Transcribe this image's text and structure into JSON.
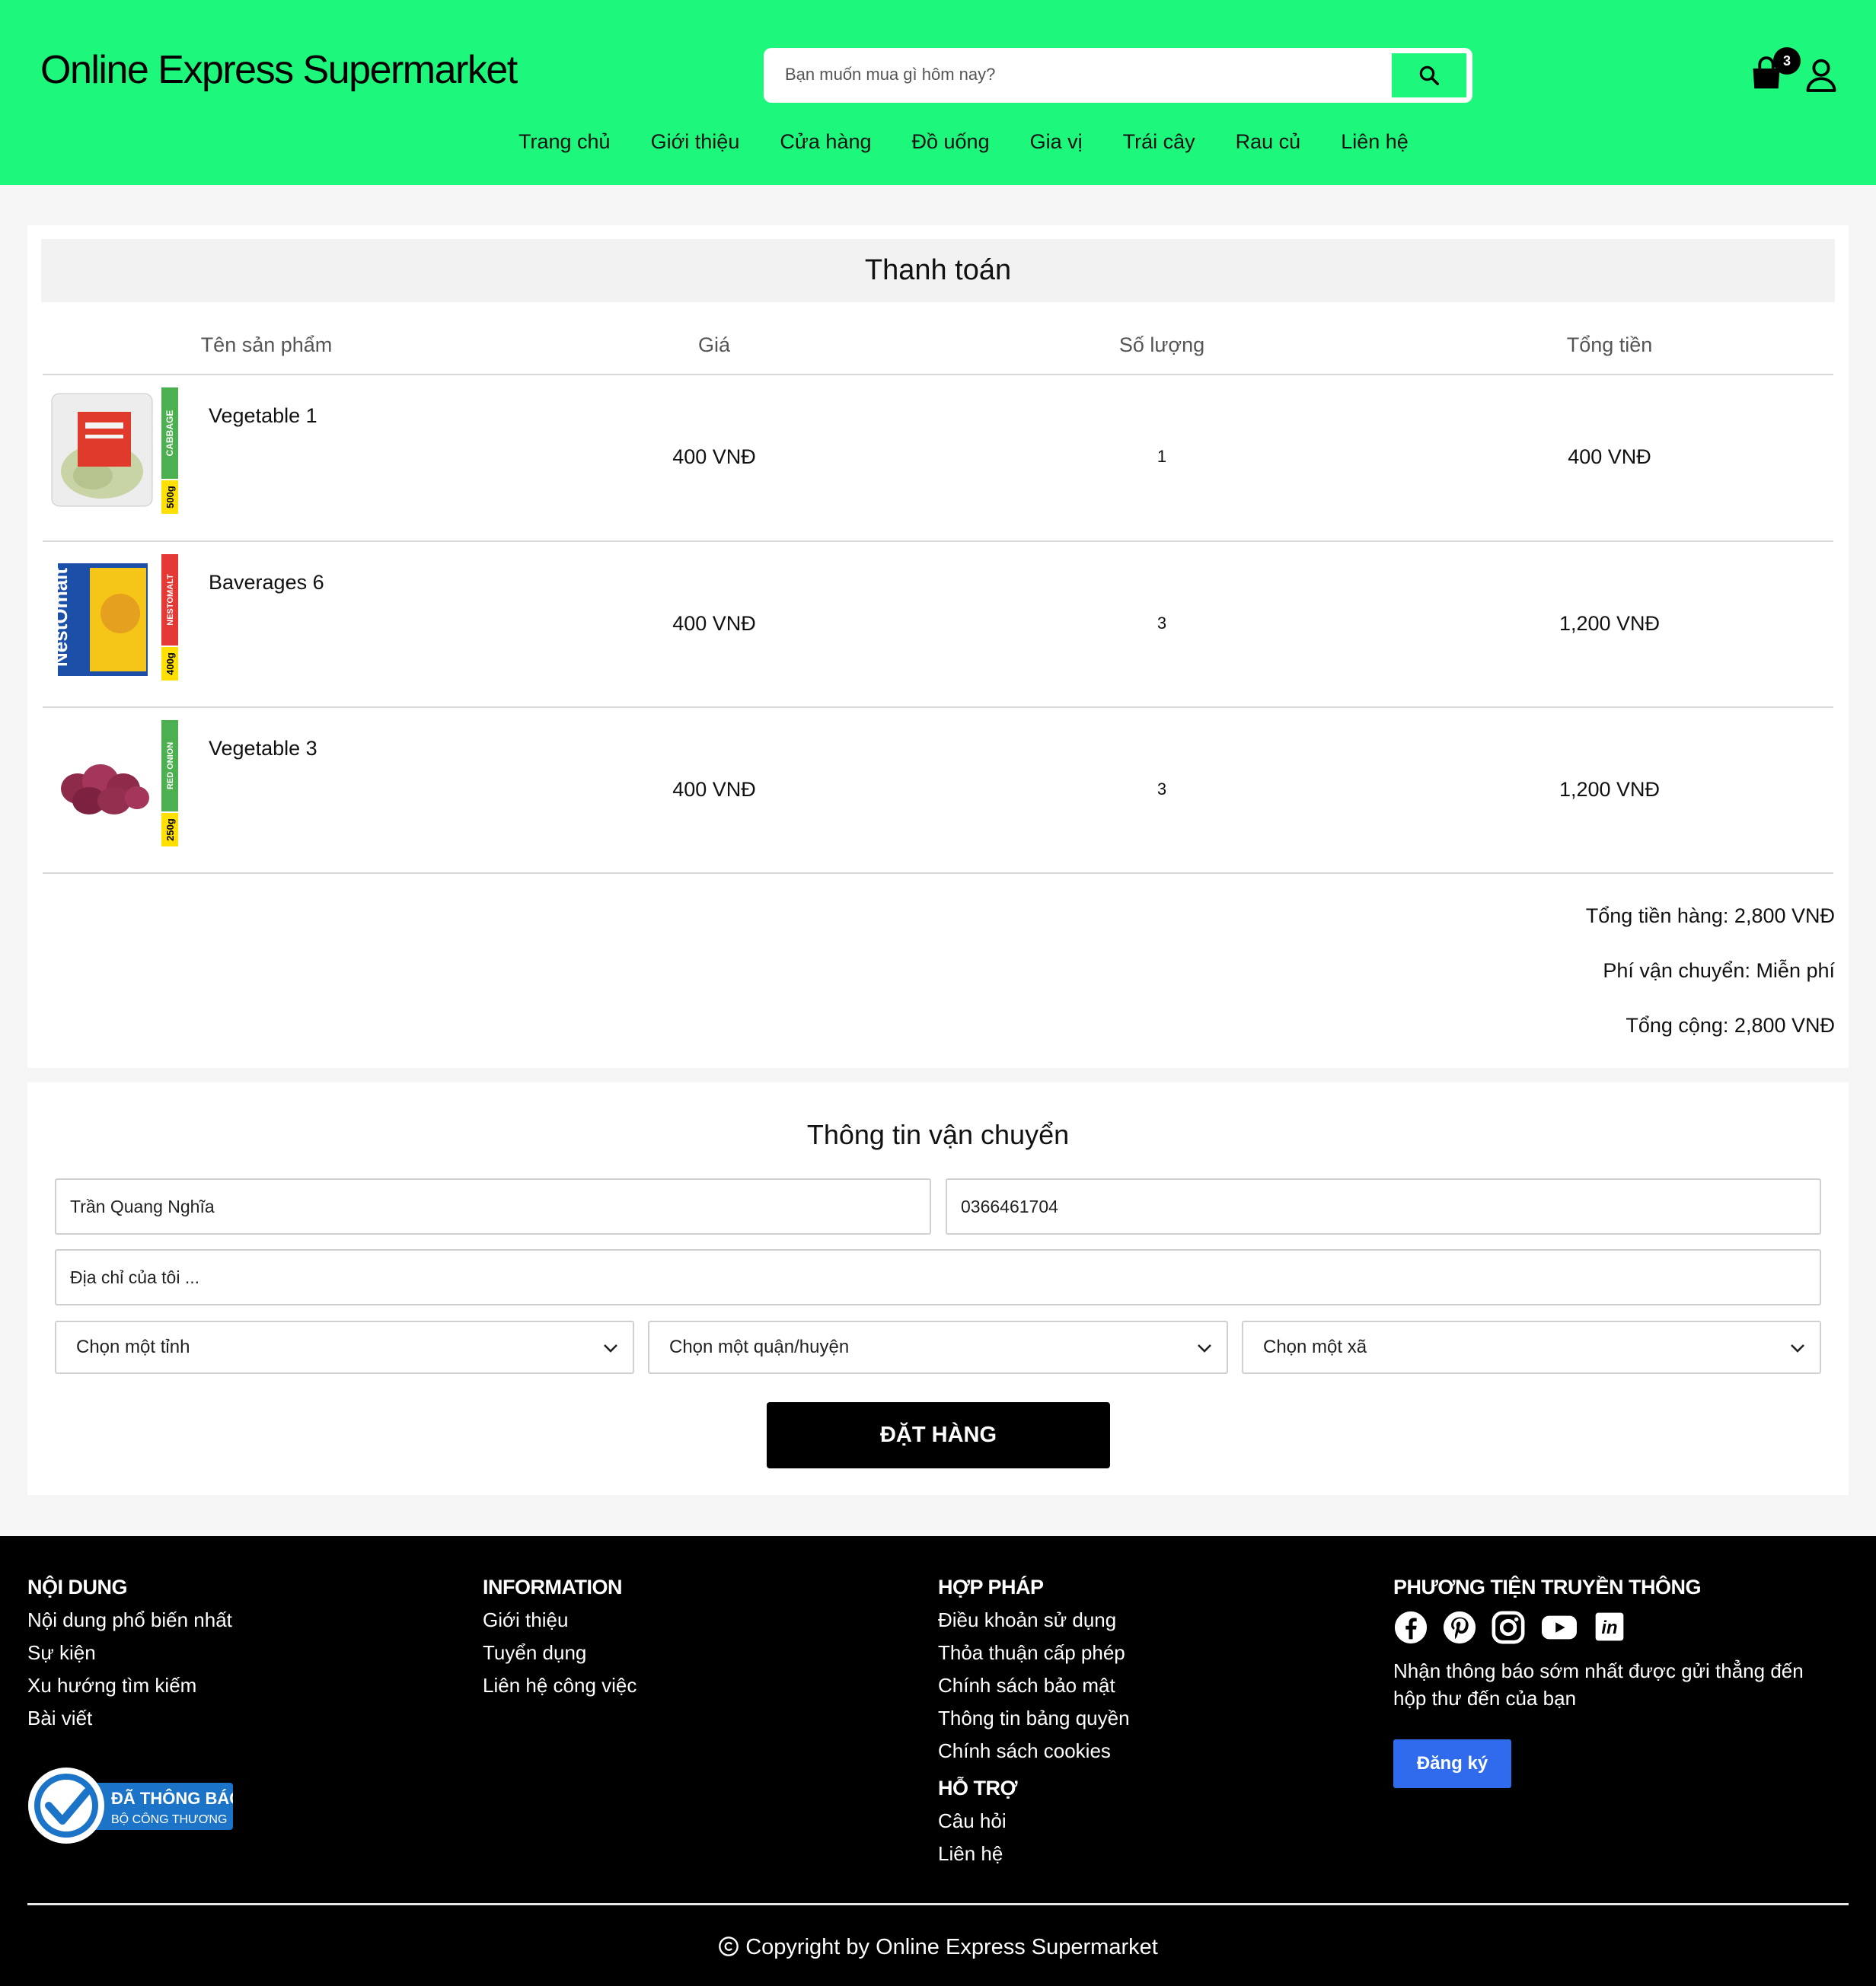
{
  "header": {
    "brand": "Online Express Supermarket",
    "search_placeholder": "Bạn muốn mua gì hôm nay?",
    "cart_count": "3",
    "nav": [
      "Trang chủ",
      "Giới thiệu",
      "Cửa hàng",
      "Đồ uống",
      "Gia vị",
      "Trái cây",
      "Rau củ",
      "Liên hệ"
    ]
  },
  "checkout": {
    "title": "Thanh toán",
    "columns": [
      "Tên sản phẩm",
      "Giá",
      "Số lượng",
      "Tổng tiền"
    ],
    "items": [
      {
        "name": "Vegetable 1",
        "price": "400 VNĐ",
        "qty": "1",
        "total": "400 VNĐ",
        "tag": "CABBAGE",
        "weight": "500g",
        "icon": "cabbage-icon"
      },
      {
        "name": "Baverages 6",
        "price": "400 VNĐ",
        "qty": "3",
        "total": "1,200 VNĐ",
        "tag": "NESTOMALT",
        "weight": "400g",
        "icon": "nestomalt-pack-icon"
      },
      {
        "name": "Vegetable 3",
        "price": "400 VNĐ",
        "qty": "3",
        "total": "1,200 VNĐ",
        "tag": "RED ONION",
        "weight": "250g",
        "icon": "red-onion-icon"
      }
    ],
    "subtotal": "Tổng tiền hàng: 2,800 VNĐ",
    "shipping": "Phí vận chuyển: Miễn phí",
    "grand_total": "Tổng cộng: 2,800 VNĐ"
  },
  "shipping_form": {
    "title": "Thông tin vận chuyển",
    "name_value": "Trần Quang Nghĩa",
    "phone_value": "0366461704",
    "address_placeholder": "Địa chỉ của tôi ...",
    "province": "Chọn một tỉnh",
    "district": "Chọn một quận/huyện",
    "ward": "Chọn một xã",
    "submit": "ĐẶT HÀNG"
  },
  "footer": {
    "col1": {
      "heading": "NỘI DUNG",
      "links": [
        "Nội dung phổ biến nhất",
        "Sự kiện",
        "Xu hướng tìm kiếm",
        "Bài viết"
      ]
    },
    "col2": {
      "heading": "INFORMATION",
      "links": [
        "Giới thiệu",
        "Tuyển dụng",
        "Liên hệ công việc"
      ]
    },
    "col3": {
      "heading": "HỢP PHÁP",
      "links": [
        "Điều khoản sử dụng",
        "Thỏa thuận cấp phép",
        "Chính sách bảo mật",
        "Thông tin bảng quyền",
        "Chính sách cookies"
      ]
    },
    "col3b": {
      "heading": "HỖ TRỢ",
      "links": [
        "Câu hỏi",
        "Liên hệ"
      ]
    },
    "col4": {
      "heading": "PHƯƠNG TIỆN TRUYỀN THÔNG",
      "newsletter": "Nhận thông báo sớm nhất được gửi thẳng đến hộp thư đến của bạn",
      "subscribe": "Đăng ký"
    },
    "social_icons": [
      "facebook-icon",
      "pinterest-icon",
      "instagram-icon",
      "youtube-icon",
      "linkedin-icon"
    ],
    "bct_badge": {
      "line1": "ĐÃ THÔNG BÁO",
      "line2": "BỘ CÔNG THƯƠNG"
    },
    "copyright": "Copyright by Online Express Supermarket"
  },
  "colors": {
    "brand_green": "#1df77b",
    "subscribe_blue": "#2f6bec"
  }
}
